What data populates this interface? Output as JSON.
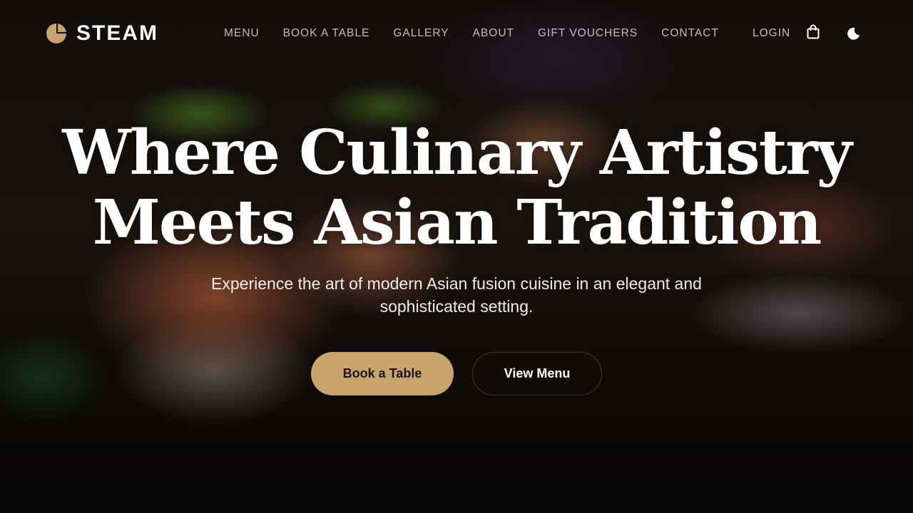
{
  "brand": {
    "name": "STEAM",
    "accent_color": "#c9a56b",
    "logo_icon": "pacman-circle-icon"
  },
  "nav": {
    "items": [
      {
        "label": "MENU"
      },
      {
        "label": "BOOK A TABLE"
      },
      {
        "label": "GALLERY"
      },
      {
        "label": "ABOUT"
      },
      {
        "label": "GIFT VOUCHERS"
      },
      {
        "label": "CONTACT"
      }
    ],
    "login_label": "LOGIN",
    "cart_icon": "shopping-bag-icon",
    "theme_icon": "moon-icon"
  },
  "hero": {
    "title_line1": "Where Culinary Artistry",
    "title_line2": "Meets Asian Tradition",
    "subtitle": "Experience the art of modern Asian fusion cuisine in an elegant and sophisticated setting.",
    "primary_button": "Book a Table",
    "secondary_button": "View Menu"
  }
}
